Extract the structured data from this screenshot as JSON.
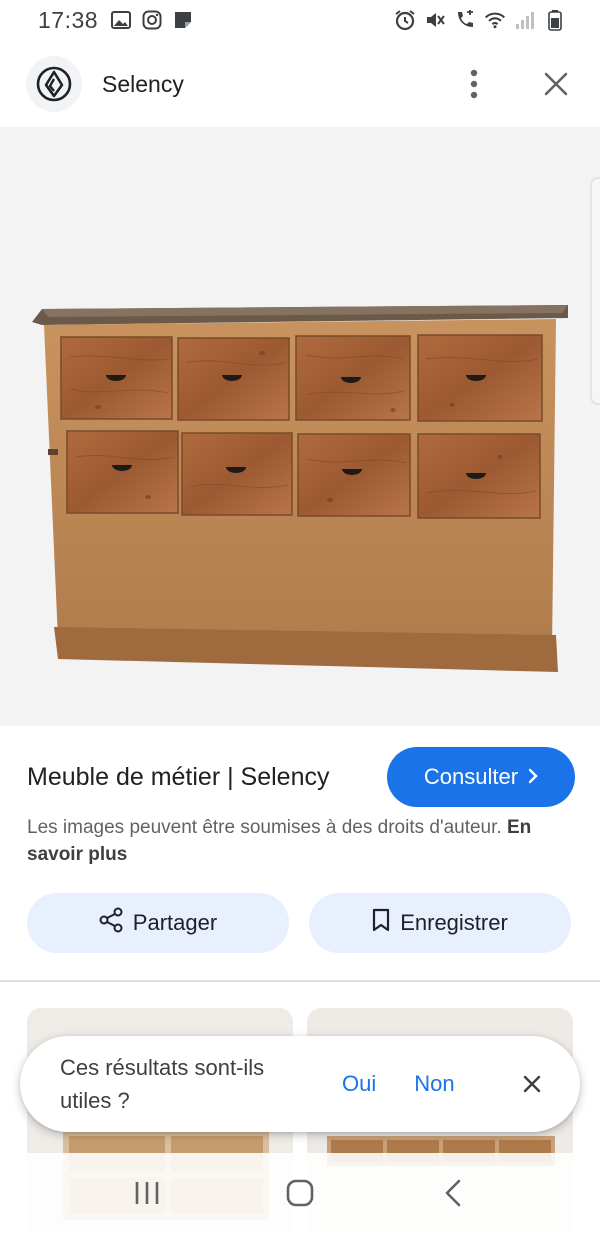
{
  "status_bar": {
    "time": "17:38",
    "left_icons": [
      "gallery-icon",
      "instagram-icon",
      "note-icon"
    ],
    "right_icons": [
      "alarm-icon",
      "mute-icon",
      "volte-icon",
      "wifi-icon",
      "signal-icon",
      "battery-icon"
    ]
  },
  "header": {
    "site_name": "Selency",
    "logo_icon": "selency-logo-icon",
    "menu_icon": "more-vert-icon",
    "close_icon": "close-icon"
  },
  "result": {
    "title": "Meuble de métier | Selency",
    "consult_label": "Consulter",
    "copyright_text": "Les images peuvent être soumises à des droits d'auteur.",
    "learn_more": "En savoir plus"
  },
  "actions": {
    "share_label": "Partager",
    "save_label": "Enregistrer"
  },
  "feedback": {
    "question": "Ces résultats sont-ils utiles ?",
    "yes": "Oui",
    "no": "Non"
  },
  "colors": {
    "accent": "#1a73e8",
    "pill_bg": "#e8f0fe",
    "image_bg": "#f3f3f3",
    "wood": "#a8643a"
  }
}
